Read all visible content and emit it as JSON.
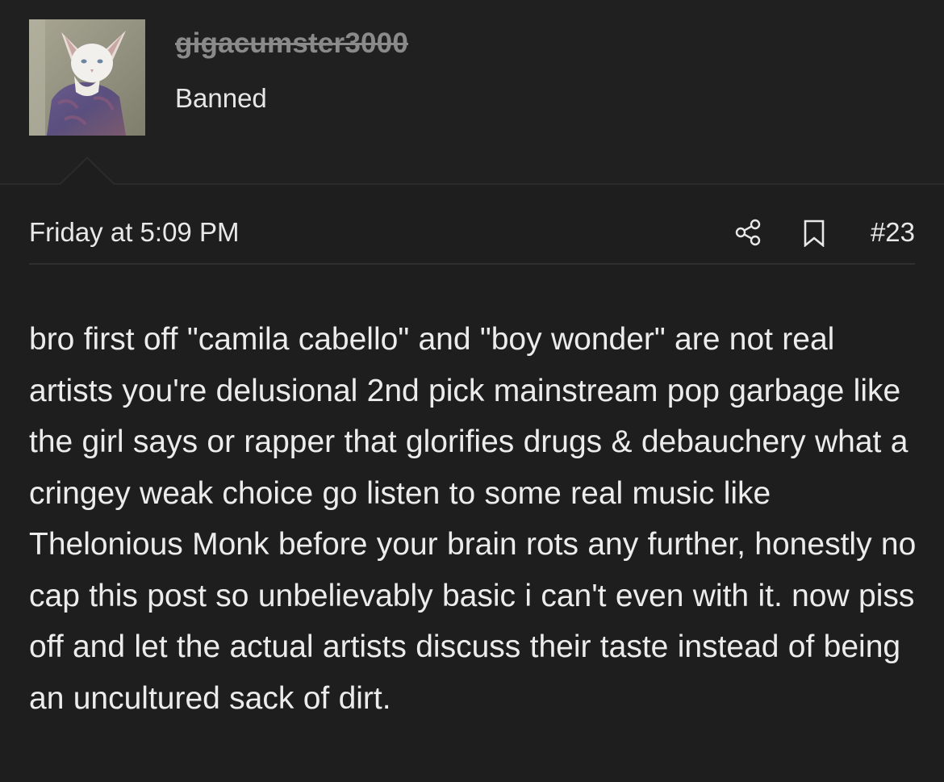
{
  "user": {
    "username": "gigacumster3000",
    "title": "Banned",
    "avatar_icon": "cat-avatar-icon"
  },
  "post": {
    "date": "Friday at 5:09 PM",
    "number": "#23",
    "share_icon": "share-icon",
    "bookmark_icon": "bookmark-icon",
    "body": "bro first off \"camila cabello\" and \"boy wonder\" are not real artists you're delusional 2nd pick mainstream pop garbage like the girl says or rapper that glorifies drugs & debauchery what a cringey weak choice go listen to some real music like Thelonious Monk before your brain rots any further, honestly no cap this post so unbelievably basic i can't even with it. now piss off and let the actual artists discuss their taste instead of being an uncultured sack of dirt."
  },
  "colors": {
    "background": "#1e1e1e",
    "text": "#e8e8e8",
    "banned_username": "#8a8a8a",
    "divider": "#2f2f2f"
  }
}
